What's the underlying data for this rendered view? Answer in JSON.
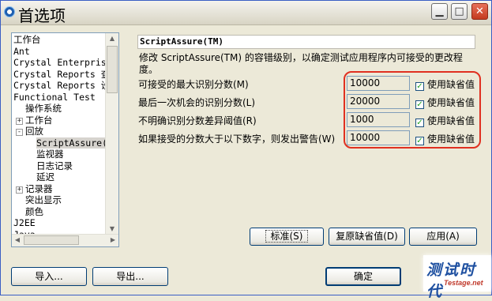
{
  "window": {
    "title": "首选项"
  },
  "tree": {
    "items": [
      {
        "label": "工作台",
        "indent": 0,
        "expander": ""
      },
      {
        "label": "Ant",
        "indent": 0,
        "expander": ""
      },
      {
        "label": "Crystal Enterprise",
        "indent": 0,
        "expander": ""
      },
      {
        "label": "Crystal Reports 查看",
        "indent": 0,
        "expander": ""
      },
      {
        "label": "Crystal Reports 设计",
        "indent": 0,
        "expander": ""
      },
      {
        "label": "Functional Test",
        "indent": 0,
        "expander": ""
      },
      {
        "label": "操作系统",
        "indent": 1,
        "expander": ""
      },
      {
        "label": "工作台",
        "indent": 1,
        "expander": "+"
      },
      {
        "label": "回放",
        "indent": 1,
        "expander": "-"
      },
      {
        "label": "ScriptAssure(TM)",
        "indent": 2,
        "expander": "",
        "selected": true
      },
      {
        "label": "监视器",
        "indent": 2,
        "expander": ""
      },
      {
        "label": "日志记录",
        "indent": 2,
        "expander": ""
      },
      {
        "label": "延迟",
        "indent": 2,
        "expander": ""
      },
      {
        "label": "记录器",
        "indent": 1,
        "expander": "+"
      },
      {
        "label": "突出显示",
        "indent": 1,
        "expander": ""
      },
      {
        "label": "颜色",
        "indent": 1,
        "expander": ""
      },
      {
        "label": "J2EE",
        "indent": 0,
        "expander": ""
      },
      {
        "label": "Java",
        "indent": 0,
        "expander": ""
      }
    ]
  },
  "panel": {
    "heading": "ScriptAssure(TM)",
    "description": "修改 ScriptAssure(TM) 的容错级别，以确定测试应用程序内可接受的更改程度。",
    "rows": [
      {
        "label": "可接受的最大识别分数(M)",
        "value": "10000",
        "checkbox_label": "使用缺省值",
        "checked": true
      },
      {
        "label": "最后一次机会的识别分数(L)",
        "value": "20000",
        "checkbox_label": "使用缺省值",
        "checked": true
      },
      {
        "label": "不明确识别分数差异阈值(R)",
        "value": "1000",
        "checkbox_label": "使用缺省值",
        "checked": true
      },
      {
        "label": "如果接受的分数大于以下数字，则发出警告(W)",
        "value": "10000",
        "checkbox_label": "使用缺省值",
        "checked": true
      }
    ]
  },
  "buttons": {
    "standard": "标准(S)",
    "restore_defaults": "复原缺省值(D)",
    "apply": "应用(A)",
    "import": "导入...",
    "export": "导出...",
    "ok": "确定"
  },
  "watermark": {
    "main": "测试时代",
    "sub": "Testage.net"
  },
  "colors": {
    "highlight": "#e03020",
    "title_bar": "#d8d4c4",
    "dialog_bg": "#ece9d8"
  }
}
